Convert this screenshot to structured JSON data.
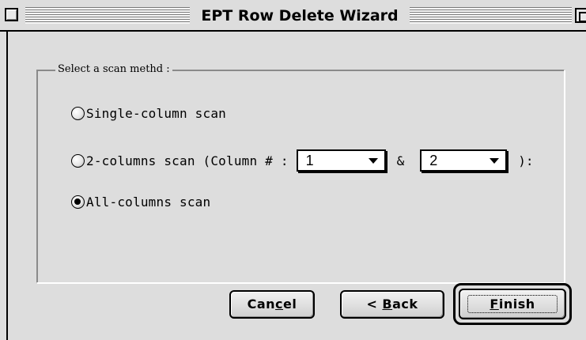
{
  "window": {
    "title": "EPT Row Delete Wizard"
  },
  "group": {
    "label": "Select a scan methd :"
  },
  "options": {
    "single": "Single-column scan",
    "two_prefix": "2-columns scan (Column # :",
    "two_and": "&",
    "two_suffix": "):",
    "all": "All-columns scan",
    "selected": "all"
  },
  "column_select_1": {
    "value": "1"
  },
  "column_select_2": {
    "value": "2"
  },
  "buttons": {
    "cancel": {
      "pre": "Can",
      "mnemonic": "c",
      "post": "el"
    },
    "back": {
      "pre": "< ",
      "mnemonic": "B",
      "post": "ack"
    },
    "finish": {
      "pre": "",
      "mnemonic": "F",
      "post": "inish"
    }
  },
  "icons": {
    "close": "close-box-icon",
    "zoom": "zoom-box-icon",
    "dropdown": "chevron-down-icon"
  }
}
